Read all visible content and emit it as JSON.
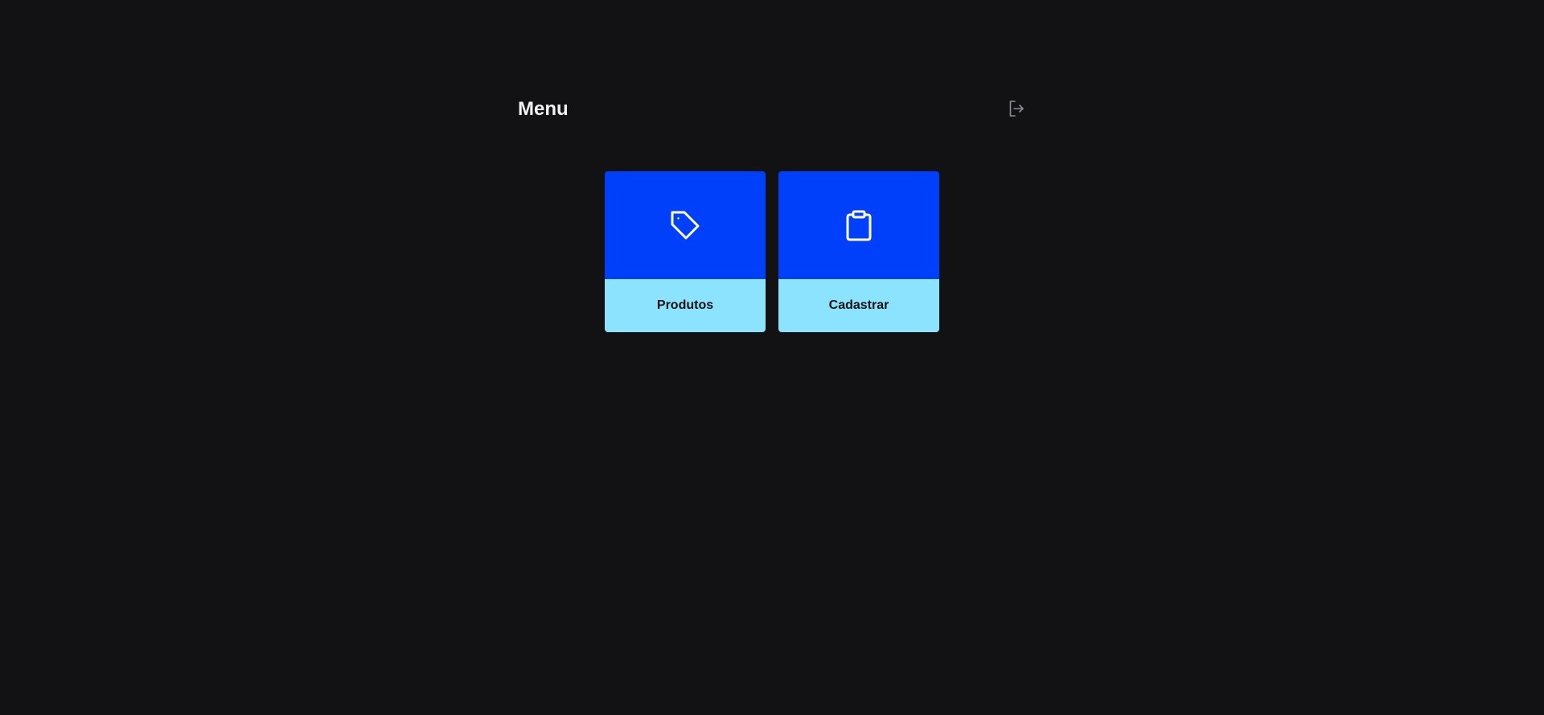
{
  "header": {
    "title": "Menu",
    "logout_icon": "logout-icon"
  },
  "colors": {
    "background": "#121214",
    "card_top": "#0040FA",
    "card_bottom": "#8BE3FD",
    "title_text": "#F2F2F2",
    "label_text": "#121214",
    "logout_icon": "#8D8D99"
  },
  "cards": [
    {
      "label": "Produtos",
      "icon": "tag-icon"
    },
    {
      "label": "Cadastrar",
      "icon": "clipboard-icon"
    }
  ]
}
